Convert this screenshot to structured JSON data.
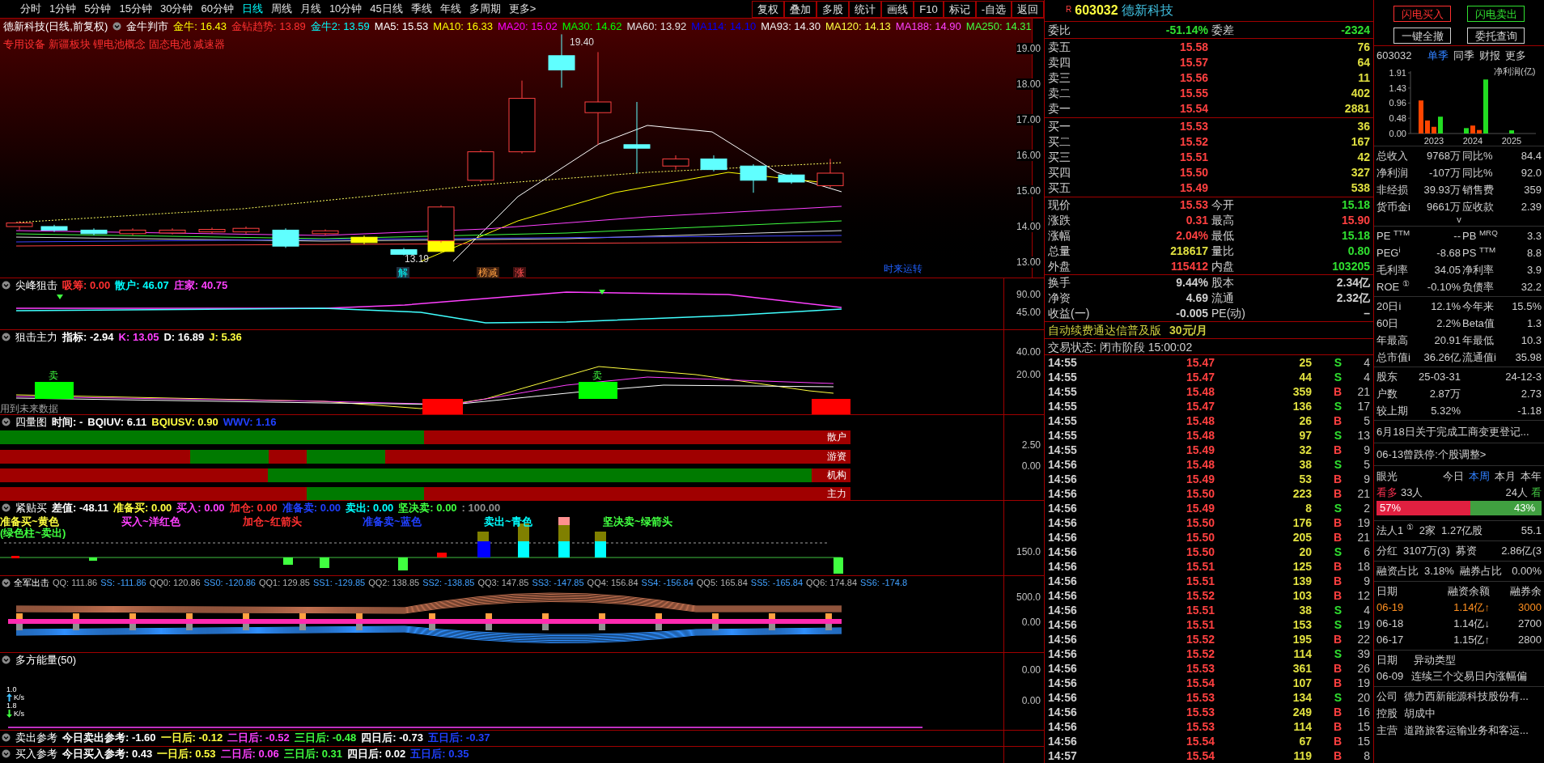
{
  "toolbar": {
    "periods": [
      {
        "label": "分时",
        "selected": false
      },
      {
        "label": "1分钟",
        "selected": false
      },
      {
        "label": "5分钟",
        "selected": false
      },
      {
        "label": "15分钟",
        "selected": false
      },
      {
        "label": "30分钟",
        "selected": false
      },
      {
        "label": "60分钟",
        "selected": false
      },
      {
        "label": "日线",
        "selected": true
      },
      {
        "label": "周线",
        "selected": false
      },
      {
        "label": "月线",
        "selected": false
      },
      {
        "label": "10分钟",
        "selected": false
      },
      {
        "label": "45日线",
        "selected": false
      },
      {
        "label": "季线",
        "selected": false
      },
      {
        "label": "年线",
        "selected": false
      },
      {
        "label": "多周期",
        "selected": false
      },
      {
        "label": "更多>",
        "selected": false
      }
    ],
    "buttons": [
      "复权",
      "叠加",
      "多股",
      "统计",
      "画线",
      "F10",
      "标记",
      "-自选",
      "返回"
    ]
  },
  "main_chart": {
    "title": "德新科技(日线,前复权)",
    "indicator": "金牛判市",
    "values": [
      {
        "text": "金牛: 16.43",
        "color": "#ffff00"
      },
      {
        "text": "金钻趋势: 13.89",
        "color": "#ff3030"
      },
      {
        "text": "金牛2: 13.59",
        "color": "#00ffff"
      },
      {
        "text": "MA5: 15.53",
        "color": "#ffffff"
      },
      {
        "text": "MA10: 16.33",
        "color": "#ffff00"
      },
      {
        "text": "MA20: 15.02",
        "color": "#ff00ff"
      },
      {
        "text": "MA30: 14.62",
        "color": "#00ff00"
      },
      {
        "text": "MA60: 13.92",
        "color": "#e0e0e0"
      },
      {
        "text": "MA114: 14.10",
        "color": "#0000ff"
      },
      {
        "text": "MA93: 14.30",
        "color": "#f0f0f0"
      },
      {
        "text": "MA120: 14.13",
        "color": "#ffff40"
      },
      {
        "text": "MA188: 14.90",
        "color": "#ff40ff"
      },
      {
        "text": "MA250: 14.31",
        "color": "#40ff40"
      }
    ],
    "tags": "专用设备 新疆板块 锂电池概念 固态电池 减速器",
    "annotations": [
      "19.40",
      "13.19",
      "解",
      "榜减",
      "涨",
      "时来运转"
    ],
    "axis_labels": [
      "19.00",
      "18.00",
      "17.00",
      "16.00",
      "15.00",
      "14.00",
      "13.00"
    ]
  },
  "indicators": [
    {
      "kind": "spike",
      "name": "尖峰狙击",
      "values": [
        {
          "text": "吸筹: 0.00",
          "color": "#ff3030"
        },
        {
          "text": "散户: 46.07",
          "color": "#00ffff"
        },
        {
          "text": "庄家: 40.75",
          "color": "#ff40ff"
        }
      ],
      "axis_labels": [
        "90.00",
        "45.00"
      ]
    },
    {
      "kind": "kdj",
      "name": "狙击主力",
      "values": [
        {
          "text": "指标: -2.94",
          "color": "#ffffff"
        },
        {
          "text": "K: 13.05",
          "color": "#ff40ff"
        },
        {
          "text": "D: 16.89",
          "color": "#ffffff"
        },
        {
          "text": "J: 5.36",
          "color": "#ffff40"
        }
      ],
      "axis_labels": [
        "40.00",
        "20.00"
      ],
      "signals": [
        "卖",
        "卖"
      ],
      "note": "用到未来数据"
    },
    {
      "kind": "quantity",
      "name": "四量图",
      "values": [
        {
          "text": "时间: -",
          "color": "#ffffff"
        },
        {
          "text": "BQIUV: 6.11",
          "color": "#ffffff"
        },
        {
          "text": "BQIUSV: 0.90",
          "color": "#ffff40"
        },
        {
          "text": "WWV: 1.16",
          "color": "#2040ff"
        }
      ],
      "axis_labels": [
        "2.50",
        "0.00"
      ],
      "rows": [
        "散户",
        "游资",
        "机构",
        "主力"
      ]
    },
    {
      "kind": "signal",
      "name": "紧贴买",
      "values": [
        {
          "text": "差值: -48.11",
          "color": "#ffffff"
        },
        {
          "text": "准备买: 0.00",
          "color": "#ffff40"
        },
        {
          "text": "买入: 0.00",
          "color": "#ff40ff"
        },
        {
          "text": "加仓: 0.00",
          "color": "#ff3030"
        },
        {
          "text": "准备卖: 0.00",
          "color": "#2040ff"
        },
        {
          "text": "卖出: 0.00",
          "color": "#00ffff"
        },
        {
          "text": "坚决卖: 0.00",
          "color": "#40ff40"
        },
        {
          "text": ": 100.00",
          "color": "#909090"
        }
      ],
      "axis_labels": [
        "150.0"
      ],
      "legend": [
        {
          "text": "准备买~黄色",
          "color": "#ffff40"
        },
        {
          "text": "(绿色柱~卖出)",
          "color": "#40ff40"
        },
        {
          "text": "买入~洋红色",
          "color": "#ff40ff"
        },
        {
          "text": "加仓~红箭头",
          "color": "#ff3030"
        },
        {
          "text": "准备卖~蓝色",
          "color": "#2040ff"
        },
        {
          "text": "卖出~青色",
          "color": "#00ffff"
        },
        {
          "text": "坚决卖~绿箭头",
          "color": "#40ff40"
        }
      ]
    },
    {
      "kind": "fan",
      "name": "全军出击",
      "values": [
        {
          "text": "QQ: 111.86",
          "color": "#b0b0b0"
        },
        {
          "text": "SS: -111.86",
          "color": "#40a0ff"
        },
        {
          "text": "QQ0: 120.86",
          "color": "#b0b0b0"
        },
        {
          "text": "SS0: -120.86",
          "color": "#40a0ff"
        },
        {
          "text": "QQ1: 129.85",
          "color": "#b0b0b0"
        },
        {
          "text": "SS1: -129.85",
          "color": "#40a0ff"
        },
        {
          "text": "QQ2: 138.85",
          "color": "#b0b0b0"
        },
        {
          "text": "SS2: -138.85",
          "color": "#40a0ff"
        },
        {
          "text": "QQ3: 147.85",
          "color": "#b0b0b0"
        },
        {
          "text": "SS3: -147.85",
          "color": "#40a0ff"
        },
        {
          "text": "QQ4: 156.84",
          "color": "#b0b0b0"
        },
        {
          "text": "SS4: -156.84",
          "color": "#40a0ff"
        },
        {
          "text": "QQ5: 165.84",
          "color": "#b0b0b0"
        },
        {
          "text": "SS5: -165.84",
          "color": "#40a0ff"
        },
        {
          "text": "QQ6: 174.84",
          "color": "#b0b0b0"
        },
        {
          "text": "SS6: -174.8",
          "color": "#40a0ff"
        }
      ],
      "axis_labels": [
        "500.0",
        "0.00"
      ]
    },
    {
      "kind": "energy",
      "name": "多方能量(50)",
      "axis_labels": [
        "0.00",
        "0.00"
      ],
      "speeds": [
        {
          "value": "1.0",
          "up": true,
          "unit": "K/s",
          "color": "#40c0ff"
        },
        {
          "value": "1.8",
          "up": false,
          "unit": "K/s",
          "color": "#40ff40"
        }
      ]
    },
    {
      "kind": "reference",
      "name": "卖出参考",
      "values": [
        {
          "text": "今日卖出参考: -1.60",
          "color": "#ffffff"
        },
        {
          "text": "一日后: -0.12",
          "color": "#ffff40"
        },
        {
          "text": "二日后: -0.52",
          "color": "#ff40ff"
        },
        {
          "text": "三日后: -0.48",
          "color": "#40ff40"
        },
        {
          "text": "四日后: -0.73",
          "color": "#ffffff"
        },
        {
          "text": "五日后: -0.37",
          "color": "#2040ff"
        }
      ]
    },
    {
      "kind": "reference",
      "name": "买入参考",
      "values": [
        {
          "text": "今日买入参考: 0.43",
          "color": "#ffffff"
        },
        {
          "text": "一日后: 0.53",
          "color": "#ffff40"
        },
        {
          "text": "二日后: 0.06",
          "color": "#ff40ff"
        },
        {
          "text": "三日后: 0.31",
          "color": "#40ff40"
        },
        {
          "text": "四日后: 0.02",
          "color": "#ffffff"
        },
        {
          "text": "五日后: 0.35",
          "color": "#2040ff"
        }
      ]
    }
  ],
  "quote": {
    "flag": "R",
    "code": "603032",
    "name": "德新科技",
    "ratio": {
      "label": "委比",
      "value": "-51.14%",
      "label2": "委差",
      "value2": "-2324"
    },
    "asks": [
      {
        "label": "卖五",
        "price": "15.58",
        "volume": "76"
      },
      {
        "label": "卖四",
        "price": "15.57",
        "volume": "64"
      },
      {
        "label": "卖三",
        "price": "15.56",
        "volume": "11"
      },
      {
        "label": "卖二",
        "price": "15.55",
        "volume": "402"
      },
      {
        "label": "卖一",
        "price": "15.54",
        "volume": "2881"
      }
    ],
    "bids": [
      {
        "label": "买一",
        "price": "15.53",
        "volume": "36"
      },
      {
        "label": "买二",
        "price": "15.52",
        "volume": "167"
      },
      {
        "label": "买三",
        "price": "15.51",
        "volume": "42"
      },
      {
        "label": "买四",
        "price": "15.50",
        "volume": "327"
      },
      {
        "label": "买五",
        "price": "15.49",
        "volume": "538"
      }
    ],
    "stats": [
      {
        "left": {
          "label": "现价",
          "value": "15.53",
          "color": "#ff4040"
        },
        "right": {
          "label": "今开",
          "value": "15.18",
          "color": "#30e030"
        }
      },
      {
        "left": {
          "label": "涨跌",
          "value": "0.31",
          "color": "#ff4040"
        },
        "right": {
          "label": "最高",
          "value": "15.90",
          "color": "#ff4040"
        }
      },
      {
        "left": {
          "label": "涨幅",
          "value": "2.04%",
          "color": "#ff4040"
        },
        "right": {
          "label": "最低",
          "value": "15.18",
          "color": "#30e030"
        }
      },
      {
        "left": {
          "label": "总量",
          "value": "218617",
          "color": "#e0e040"
        },
        "right": {
          "label": "量比",
          "value": "0.80",
          "color": "#30e030"
        }
      },
      {
        "left": {
          "label": "外盘",
          "value": "115412",
          "color": "#ff4040"
        },
        "right": {
          "label": "内盘",
          "value": "103205",
          "color": "#30e030"
        }
      }
    ],
    "capital": [
      {
        "label": "换手",
        "value": "9.44%",
        "label2": "股本",
        "value2": "2.34亿"
      },
      {
        "label": "净资",
        "value": "4.69",
        "label2": "流通",
        "value2": "2.32亿"
      },
      {
        "label": "收益(一)",
        "value": "-0.005",
        "label2": "PE(动)",
        "value2": "–"
      }
    ],
    "promo": {
      "text": "自动续费通达信普及版",
      "price": "30元/月"
    },
    "status": "交易状态: 闭市阶段 15:00:02",
    "ticks": [
      {
        "time": "14:55",
        "price": "15.47",
        "volume": "25",
        "side": "S",
        "buy": false,
        "count": "4"
      },
      {
        "time": "14:55",
        "price": "15.47",
        "volume": "44",
        "side": "S",
        "buy": false,
        "count": "4"
      },
      {
        "time": "14:55",
        "price": "15.48",
        "volume": "359",
        "side": "B",
        "buy": true,
        "count": "21"
      },
      {
        "time": "14:55",
        "price": "15.47",
        "volume": "136",
        "side": "S",
        "buy": false,
        "count": "17"
      },
      {
        "time": "14:55",
        "price": "15.48",
        "volume": "26",
        "side": "B",
        "buy": true,
        "count": "5"
      },
      {
        "time": "14:55",
        "price": "15.48",
        "volume": "97",
        "side": "S",
        "buy": false,
        "count": "13"
      },
      {
        "time": "14:55",
        "price": "15.49",
        "volume": "32",
        "side": "B",
        "buy": true,
        "count": "9"
      },
      {
        "time": "14:56",
        "price": "15.48",
        "volume": "38",
        "side": "S",
        "buy": false,
        "count": "5"
      },
      {
        "time": "14:56",
        "price": "15.49",
        "volume": "53",
        "side": "B",
        "buy": true,
        "count": "9"
      },
      {
        "time": "14:56",
        "price": "15.50",
        "volume": "223",
        "side": "B",
        "buy": true,
        "count": "21"
      },
      {
        "time": "14:56",
        "price": "15.49",
        "volume": "8",
        "side": "S",
        "buy": false,
        "count": "2"
      },
      {
        "time": "14:56",
        "price": "15.50",
        "volume": "176",
        "side": "B",
        "buy": true,
        "count": "19"
      },
      {
        "time": "14:56",
        "price": "15.50",
        "volume": "205",
        "side": "B",
        "buy": true,
        "count": "21"
      },
      {
        "time": "14:56",
        "price": "15.50",
        "volume": "20",
        "side": "S",
        "buy": false,
        "count": "6"
      },
      {
        "time": "14:56",
        "price": "15.51",
        "volume": "125",
        "side": "B",
        "buy": true,
        "count": "18"
      },
      {
        "time": "14:56",
        "price": "15.51",
        "volume": "139",
        "side": "B",
        "buy": true,
        "count": "9"
      },
      {
        "time": "14:56",
        "price": "15.52",
        "volume": "103",
        "side": "B",
        "buy": true,
        "count": "12"
      },
      {
        "time": "14:56",
        "price": "15.51",
        "volume": "38",
        "side": "S",
        "buy": false,
        "count": "4"
      },
      {
        "time": "14:56",
        "price": "15.51",
        "volume": "153",
        "side": "S",
        "buy": false,
        "count": "19"
      },
      {
        "time": "14:56",
        "price": "15.52",
        "volume": "195",
        "side": "B",
        "buy": true,
        "count": "22"
      },
      {
        "time": "14:56",
        "price": "15.52",
        "volume": "114",
        "side": "S",
        "buy": false,
        "count": "39"
      },
      {
        "time": "14:56",
        "price": "15.53",
        "volume": "361",
        "side": "B",
        "buy": true,
        "count": "26"
      },
      {
        "time": "14:56",
        "price": "15.54",
        "volume": "107",
        "side": "B",
        "buy": true,
        "count": "19"
      },
      {
        "time": "14:56",
        "price": "15.53",
        "volume": "134",
        "side": "S",
        "buy": false,
        "count": "20"
      },
      {
        "time": "14:56",
        "price": "15.53",
        "volume": "249",
        "side": "B",
        "buy": true,
        "count": "16"
      },
      {
        "time": "14:56",
        "price": "15.53",
        "volume": "114",
        "side": "B",
        "buy": true,
        "count": "15"
      },
      {
        "time": "14:56",
        "price": "15.54",
        "volume": "67",
        "side": "B",
        "buy": true,
        "count": "15"
      },
      {
        "time": "14:57",
        "price": "15.54",
        "volume": "119",
        "side": "B",
        "buy": true,
        "count": "8"
      }
    ]
  },
  "side": {
    "trade_buttons": [
      {
        "label": "闪电买入",
        "kind": "buy"
      },
      {
        "label": "闪电卖出",
        "kind": "sell"
      },
      {
        "label": "一键全撤",
        "kind": "plain"
      },
      {
        "label": "委托查询",
        "kind": "plain"
      }
    ],
    "finance": {
      "code": "603032",
      "tabs": [
        {
          "label": "单季",
          "selected": true
        },
        {
          "label": "同季",
          "selected": false
        },
        {
          "label": "财报",
          "selected": false
        },
        {
          "label": "更多",
          "selected": false
        }
      ],
      "chart_data": {
        "type": "bar",
        "title": "净利润(亿)",
        "categories": [
          null,
          null,
          "2023",
          null,
          null,
          null,
          null,
          null,
          "2024",
          null,
          null,
          null,
          null,
          null,
          "2025"
        ],
        "ylim": [
          0,
          1.91
        ],
        "yticks": [
          {
            "value": 0,
            "label": "0.00"
          },
          {
            "value": 0.48,
            "label": "0.48"
          },
          {
            "value": 0.96,
            "label": "0.96"
          },
          {
            "value": 1.43,
            "label": "1.43"
          },
          {
            "value": 1.91,
            "label": "1.91"
          }
        ],
        "series": [
          {
            "color": "#ff4500",
            "values": [
              1.04,
              0.41,
              0.21,
              null,
              null,
              null,
              null,
              null,
              0.25,
              0.11,
              null,
              null,
              null,
              null,
              null
            ]
          },
          {
            "color": "#22dd22",
            "values": [
              null,
              null,
              null,
              0.53,
              null,
              null,
              null,
              0.17,
              null,
              null,
              1.7,
              null,
              null,
              null,
              0.1
            ]
          }
        ]
      }
    },
    "metric_groups": [
      [
        [
          "总收入",
          "9768万",
          "同比%",
          "84.4"
        ],
        [
          "净利润",
          "-107万",
          "同比%",
          "92.0"
        ],
        [
          "非经损",
          "39.93万",
          "销售费",
          "359"
        ],
        [
          "货币金i",
          "9661万",
          "应收款",
          "2.39"
        ]
      ],
      [
        [
          "PE $^{TTM}$",
          "--",
          "PB $^{MRQ}$",
          "3.3"
        ],
        [
          "PEG$^{i}$",
          "-8.68",
          "PS $^{TTM}$",
          "8.8"
        ],
        [
          "毛利率",
          "34.05",
          "净利率",
          "3.9"
        ],
        [
          "ROE $^{①}$",
          "-0.10%",
          "负债率",
          "32.2"
        ]
      ],
      [
        [
          "20日i",
          "12.1%",
          "今年来",
          "15.5%"
        ],
        [
          "60日",
          "2.2%",
          "Beta值",
          "1.3"
        ],
        [
          "年最高",
          "20.91",
          "年最低",
          "10.3"
        ],
        [
          "总市值i",
          "36.26亿",
          "流通值i",
          "35.98"
        ]
      ],
      [
        [
          "股东",
          "25-03-31",
          "24-12-3"
        ],
        [
          "户数",
          "2.87万",
          "2.73"
        ],
        [
          "较上期",
          "5.32%",
          "-1.18"
        ]
      ]
    ],
    "expand": "v",
    "notices": [
      "6月18日关于完成工商变更登记...",
      "06-13曾跌停:个股调整>"
    ],
    "sentiment": {
      "title": "眼光",
      "periods": [
        {
          "label": "今日",
          "selected": false
        },
        {
          "label": "本周",
          "selected": true
        },
        {
          "label": "本月",
          "selected": false
        },
        {
          "label": "本年",
          "selected": false
        }
      ],
      "bull_label": "看多",
      "bull_count": "33人",
      "bear_count": "24人",
      "bear_label": "看",
      "level": 0.57,
      "bull_pct": "57%",
      "bear_pct": "43%"
    },
    "holders": [
      [
        "法人1 $^{①}$",
        "2家",
        "1.27亿股",
        "55.1"
      ],
      [
        "分红",
        "3107万(3)",
        "募资",
        "2.86亿(3"
      ],
      [
        "融资占比",
        "3.18%",
        "融券占比",
        "0.00%"
      ]
    ],
    "margin": {
      "columns": [
        "日期",
        "融资余额",
        "融券余"
      ],
      "rows": [
        {
          "date": "06-19",
          "balance": "1.14亿↑",
          "short": "3000",
          "highlighted": true
        },
        {
          "date": "06-18",
          "balance": "1.14亿↓",
          "short": "2700",
          "highlighted": false
        },
        {
          "date": "06-17",
          "balance": "1.15亿↑",
          "short": "2800",
          "highlighted": false
        }
      ]
    },
    "events": {
      "columns": [
        "日期",
        "异动类型"
      ],
      "rows": [
        [
          "06-09",
          "连续三个交易日内涨幅偏"
        ]
      ]
    },
    "company": [
      [
        "公司",
        "德力西新能源科技股份有..."
      ],
      [
        "控股",
        "胡成中"
      ],
      [
        "主营",
        "道路旅客运输业务和客运..."
      ]
    ]
  }
}
